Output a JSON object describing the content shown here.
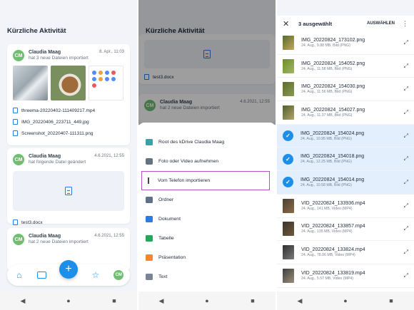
{
  "left_panel": {
    "title": "Kürzliche Aktivität",
    "cards": [
      {
        "avatar": "CM",
        "name": "Claudia Maag",
        "subtitle": "hat 3 neue Dateien importiert",
        "date": "8. Apr., 11:03",
        "files": [
          "threema-20220402-111409217.mp4",
          "IMG_20220406_223711_449.jpg",
          "Screenshot_20220407-111311.png"
        ]
      },
      {
        "avatar": "CM",
        "name": "Claudia Maag",
        "subtitle": "hat folgende Datei geändert",
        "date": "4.6.2021, 12:55",
        "files": [
          "test3.docx"
        ]
      },
      {
        "avatar": "CM",
        "name": "Claudia Maag",
        "subtitle": "hat 2 neue Dateien importiert",
        "date": "4.6.2021, 12:55"
      }
    ],
    "nav": {
      "fab": "+",
      "avatar": "CM"
    }
  },
  "middle_panel": {
    "title": "Kürzliche Aktivität",
    "background_file": "test3.docx",
    "background_card": {
      "name": "Claudia Maag",
      "subtitle": "hat 2 neue Dateien importiert",
      "date": "4.6.2021, 12:55"
    },
    "menu": [
      {
        "label": "Root des kDrive Claudia Maag",
        "icon": "root-icon"
      },
      {
        "label": "Foto oder Video aufnehmen",
        "icon": "camera-icon"
      },
      {
        "label": "Vom Telefon importieren",
        "icon": "upload-icon",
        "highlighted": true
      },
      {
        "label": "Ordner",
        "icon": "folder-icon"
      },
      {
        "label": "Dokument",
        "icon": "document-icon"
      },
      {
        "label": "Tabelle",
        "icon": "spreadsheet-icon"
      },
      {
        "label": "Präsentation",
        "icon": "presentation-icon"
      },
      {
        "label": "Text",
        "icon": "text-icon"
      }
    ]
  },
  "right_panel": {
    "header": {
      "close": "✕",
      "count": "3 ausgewählt",
      "select_all": "AUSWÄHLEN",
      "more": "⋮"
    },
    "items": [
      {
        "name": "IMG_20220824_173102.png",
        "meta": "24. Aug., 9.88 MB, Bild (PNG)",
        "selected": false
      },
      {
        "name": "IMG_20220824_154052.png",
        "meta": "24. Aug., 11.58 MB, Bild (PNG)",
        "selected": false
      },
      {
        "name": "IMG_20220824_154030.png",
        "meta": "24. Aug., 11.56 MB, Bild (PNG)",
        "selected": false
      },
      {
        "name": "IMG_20220824_154027.png",
        "meta": "24. Aug., 11.37 MB, Bild (PNG)",
        "selected": false
      },
      {
        "name": "IMG_20220824_154024.png",
        "meta": "24. Aug., 10.95 MB, Bild (PNG)",
        "selected": true
      },
      {
        "name": "IMG_20220824_154018.png",
        "meta": "24. Aug., 12.25 MB, Bild (PNG)",
        "selected": true
      },
      {
        "name": "IMG_20220824_154014.png",
        "meta": "24. Aug., 10.58 MB, Bild (PNG)",
        "selected": true
      },
      {
        "name": "VID_20220824_133936.mp4",
        "meta": "24. Aug., 141 MB, Video (MP4)",
        "selected": false
      },
      {
        "name": "VID_20220824_133857.mp4",
        "meta": "24. Aug., 135 MB, Video (MP4)",
        "selected": false
      },
      {
        "name": "VID_20220824_133824.mp4",
        "meta": "24. Aug., 78.06 MB, Video (MP4)",
        "selected": false
      },
      {
        "name": "VID_20220824_133819.mp4",
        "meta": "24. Aug., 5.57 MB, Video (MP4)",
        "selected": false
      }
    ]
  },
  "system_nav": {
    "back": "◀",
    "home": "●",
    "recents": "■"
  }
}
